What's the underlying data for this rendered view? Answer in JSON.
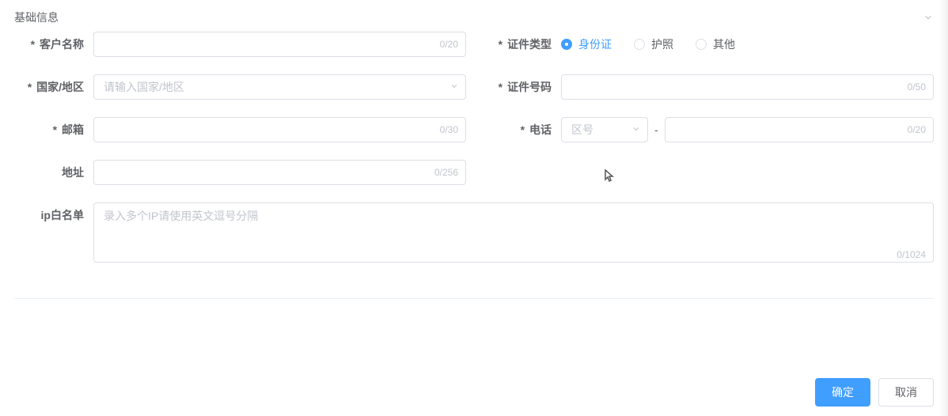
{
  "section": {
    "title": "基础信息"
  },
  "labels": {
    "customerName": "客户名称",
    "country": "国家/地区",
    "email": "邮箱",
    "address": "地址",
    "ipWhitelist": "ip白名单",
    "idType": "证件类型",
    "idNumber": "证件号码",
    "phone": "电话"
  },
  "placeholders": {
    "country": "请输入国家/地区",
    "areaCode": "区号",
    "ipWhitelist": "录入多个IP请使用英文逗号分隔"
  },
  "counters": {
    "customerName": "0/20",
    "email": "0/30",
    "address": "0/256",
    "idNumber": "0/50",
    "phone": "0/20",
    "ipWhitelist": "0/1024"
  },
  "radios": {
    "idCard": "身份证",
    "passport": "护照",
    "other": "其他"
  },
  "phoneSeparator": "-",
  "buttons": {
    "confirm": "确定",
    "cancel": "取消"
  }
}
